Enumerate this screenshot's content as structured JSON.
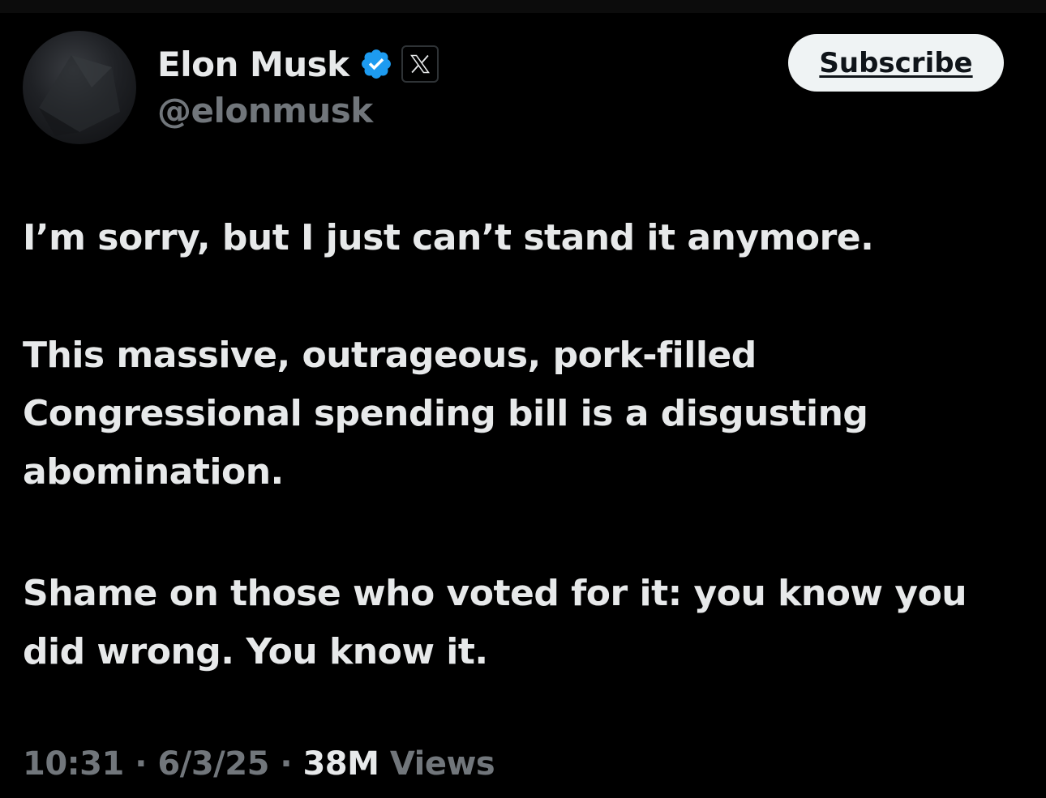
{
  "author": {
    "display_name": "Elon Musk",
    "handle": "@elonmusk",
    "verified_icon": "verified-badge-icon",
    "affiliation_icon": "x-logo-icon"
  },
  "actions": {
    "subscribe_label": "Subscribe"
  },
  "post": {
    "paragraph_1": "I’m sorry, but I just can’t stand it anymore.",
    "paragraph_2_lines": [
      "This massive, outrageous, pork-filled",
      "Congressional spending bill is a disgusting",
      "abomination."
    ],
    "paragraph_3_lines": [
      "Shame on those who voted for it: you know you",
      "did wrong. You know it."
    ]
  },
  "meta": {
    "time": "10:31",
    "separator": " · ",
    "date": "6/3/25",
    "views_count": "38M",
    "views_label": " Views"
  },
  "colors": {
    "background": "#000000",
    "text_primary": "#e7e9ea",
    "text_secondary": "#71767b",
    "verified_blue": "#1d9bf0",
    "button_bg": "#eff3f4"
  }
}
